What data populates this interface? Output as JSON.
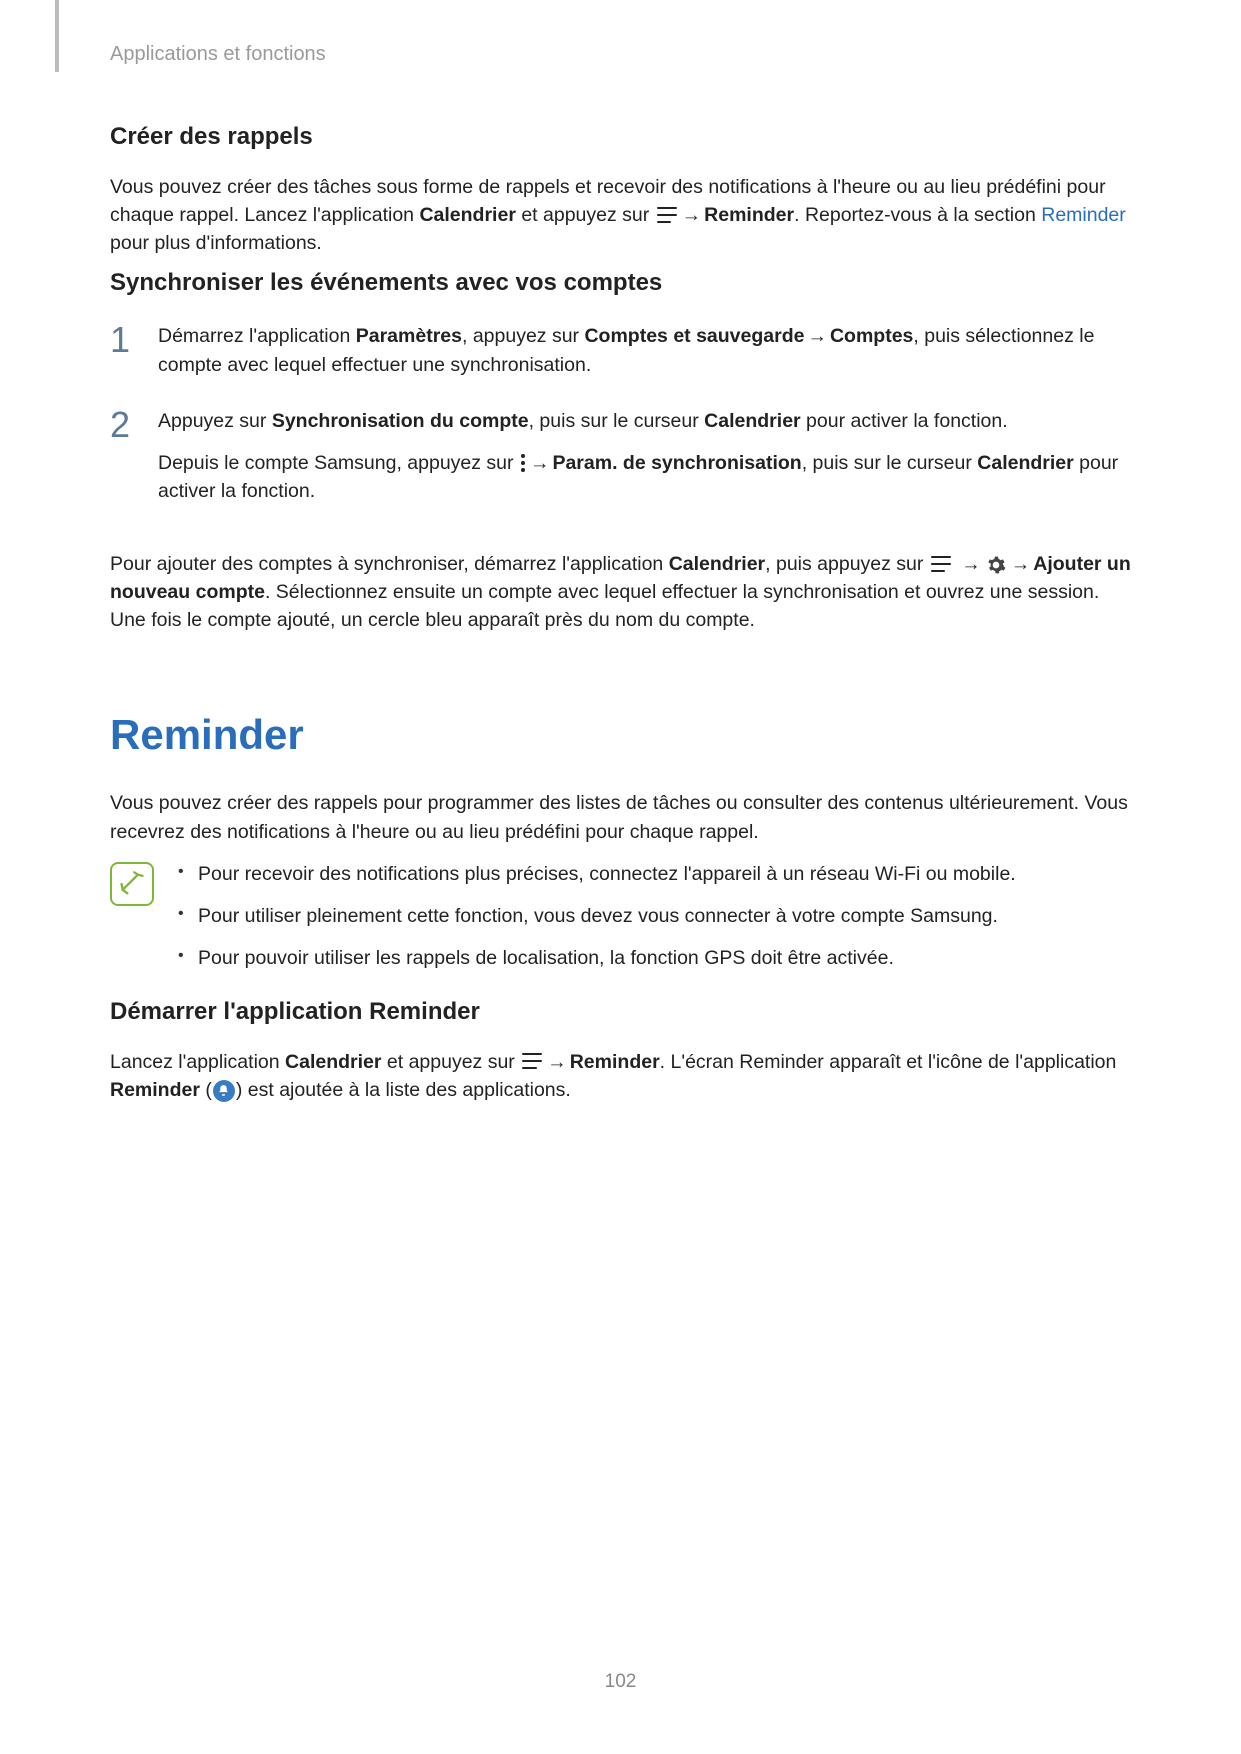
{
  "header": {
    "breadcrumb": "Applications et fonctions"
  },
  "s1": {
    "title": "Créer des rappels",
    "p1a": "Vous pouvez créer des tâches sous forme de rappels et recevoir des notifications à l'heure ou au lieu prédéfini pour chaque rappel. Lancez l'application ",
    "p1b": "Calendrier",
    "p1c": " et appuyez sur ",
    "p1d": "Reminder",
    "p1e": ". Reportez-vous à la section ",
    "p1f": "Reminder",
    "p1g": " pour plus d'informations."
  },
  "s2": {
    "title": "Synchroniser les événements avec vos comptes",
    "step1": {
      "a": "Démarrez l'application ",
      "b": "Paramètres",
      "c": ", appuyez sur ",
      "d": "Comptes et sauvegarde",
      "e": "Comptes",
      "f": ", puis sélectionnez le compte avec lequel effectuer une synchronisation."
    },
    "step2": {
      "a": "Appuyez sur ",
      "b": "Synchronisation du compte",
      "c": ", puis sur le curseur ",
      "d": "Calendrier",
      "e": " pour activer la fonction.",
      "sub_a": "Depuis le compte Samsung, appuyez sur ",
      "sub_b": "Param. de synchronisation",
      "sub_c": ", puis sur le curseur ",
      "sub_d": "Calendrier",
      "sub_e": " pour activer la fonction."
    },
    "after": {
      "a": "Pour ajouter des comptes à synchroniser, démarrez l'application ",
      "b": "Calendrier",
      "c": ", puis appuyez sur ",
      "d": "Ajouter un nouveau compte",
      "e": ". Sélectionnez ensuite un compte avec lequel effectuer la synchronisation et ouvrez une session. Une fois le compte ajouté, un cercle bleu apparaît près du nom du compte."
    }
  },
  "reminder": {
    "title": "Reminder",
    "intro": "Vous pouvez créer des rappels pour programmer des listes de tâches ou consulter des contenus ultérieurement. Vous recevrez des notifications à l'heure ou au lieu prédéfini pour chaque rappel.",
    "bullets": [
      "Pour recevoir des notifications plus précises, connectez l'appareil à un réseau Wi-Fi ou mobile.",
      "Pour utiliser pleinement cette fonction, vous devez vous connecter à votre compte Samsung.",
      "Pour pouvoir utiliser les rappels de localisation, la fonction GPS doit être activée."
    ],
    "start": {
      "title": "Démarrer l'application Reminder",
      "a": "Lancez l'application ",
      "b": "Calendrier",
      "c": " et appuyez sur ",
      "d": "Reminder",
      "e": ". L'écran Reminder apparaît et l'icône de l'application ",
      "f": "Reminder",
      "g": " (",
      "h": ") est ajoutée à la liste des applications."
    }
  },
  "arrow": "→",
  "page_number": "102"
}
